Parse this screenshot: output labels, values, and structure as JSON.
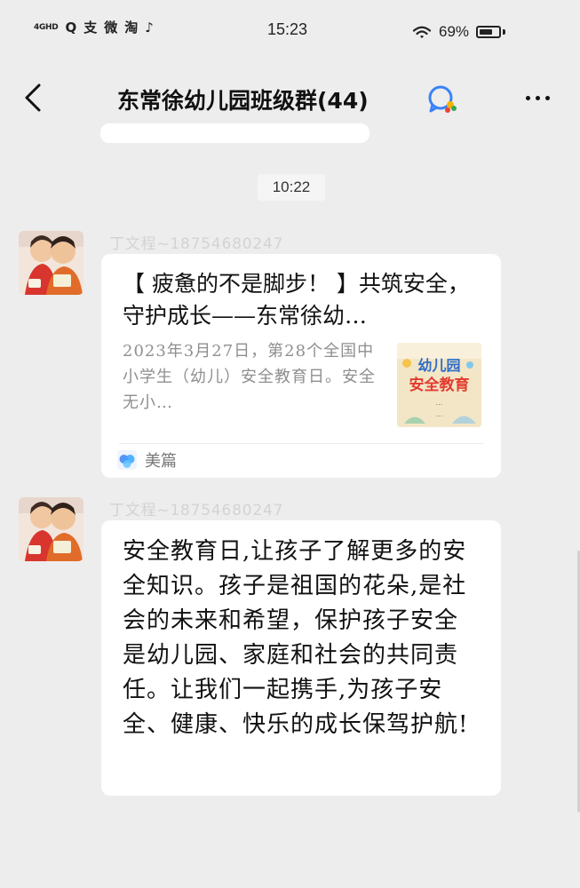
{
  "status_bar": {
    "network": "4GHD",
    "app_icons": [
      "Q",
      "支",
      "微",
      "淘",
      "♪"
    ],
    "time": "15:23",
    "battery_percent": "69%",
    "battery_level": 0.69
  },
  "header": {
    "title": "东常徐幼儿园班级群(44)"
  },
  "chat": {
    "timestamp": "10:22",
    "messages": [
      {
        "sender": "丁文程~18754680247",
        "type": "link",
        "title": "【 疲惫的不是脚步！ 】共筑安全，守护成长——东常徐幼…",
        "description": "2023年3月27日，第28个全国中小学生（幼儿）安全教育日。安全无小…",
        "thumbnail_text": {
          "line1": "幼儿园",
          "line2": "安全教育",
          "line3": "...",
          "line4": "..."
        },
        "source": "美篇"
      },
      {
        "sender": "丁文程~18754680247",
        "type": "text",
        "text": "安全教育日,让孩子了解更多的安全知识。孩子是祖国的花朵,是社会的未来和希望，保护孩子安全是幼儿园、家庭和社会的共同责任。让我们一起携手,为孩子安全、健康、快乐的成长保驾护航!"
      }
    ]
  },
  "colors": {
    "background": "#ededed",
    "bubble": "#ffffff",
    "secondary_text": "#8f8f8f",
    "sender_text": "#d3d3d3",
    "meipian_blue": "#3a82f7"
  }
}
